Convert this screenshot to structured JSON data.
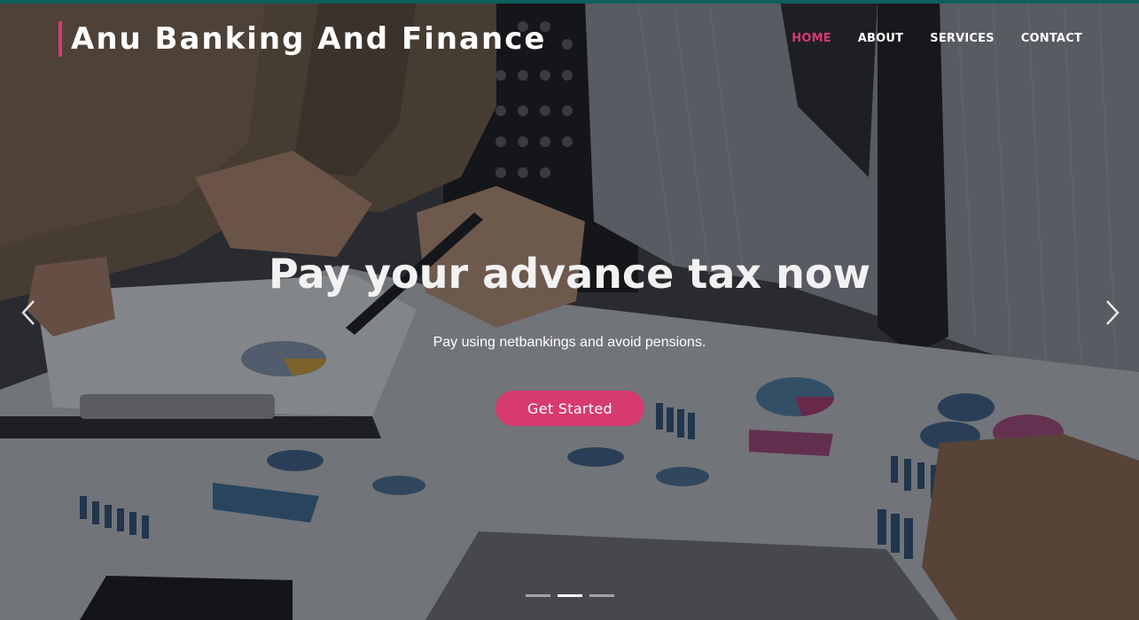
{
  "brand": {
    "name": "Anu Banking And Finance"
  },
  "nav": {
    "items": [
      "HOME",
      "ABOUT",
      "SERVICES",
      "CONTACT"
    ],
    "active": "HOME"
  },
  "hero": {
    "title": "Pay your advance tax now",
    "subtitle": "Pay using netbankings and avoid pensions.",
    "cta_label": "Get Started"
  },
  "carousel": {
    "slide_count": 3,
    "active_index": 1
  },
  "icons": {
    "prev": "chevron-left-icon",
    "next": "chevron-right-icon"
  },
  "colors": {
    "accent": "#d63a6f",
    "top_bar": "#0f5f5c",
    "text": "#ffffff"
  }
}
